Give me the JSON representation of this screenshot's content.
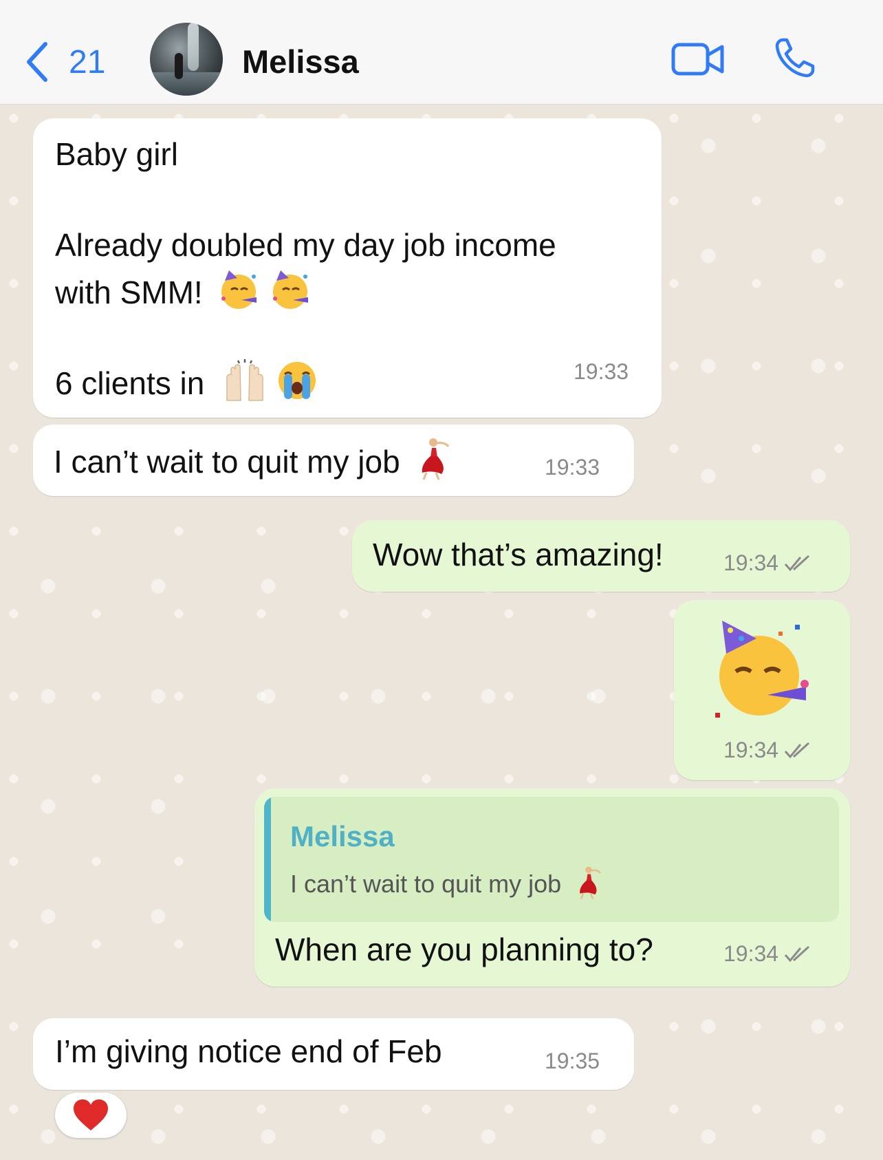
{
  "header": {
    "back_count": "21",
    "contact_name": "Melissa",
    "icons": [
      "chevron-left-icon",
      "video-call-icon",
      "phone-call-icon"
    ]
  },
  "messages": [
    {
      "direction": "incoming",
      "lines": [
        "Baby girl",
        "",
        "Already doubled my day job income",
        "with SMM!",
        "",
        "6 clients in"
      ],
      "emojis": [
        "partying-face",
        "partying-face",
        "raising-hands",
        "loudly-crying-face"
      ],
      "time": "19:33"
    },
    {
      "direction": "incoming",
      "text": "I can’t wait to quit my job",
      "emojis": [
        "woman-dancing"
      ],
      "time": "19:33"
    },
    {
      "direction": "outgoing",
      "text": "Wow that’s amazing!",
      "time": "19:34",
      "status": "read"
    },
    {
      "direction": "outgoing",
      "sticker": "partying-face",
      "time": "19:34",
      "status": "read"
    },
    {
      "direction": "outgoing",
      "reply": {
        "name": "Melissa",
        "text": "I can’t wait to quit my job"
      },
      "text": "When are you planning to?",
      "time": "19:34",
      "status": "read"
    },
    {
      "direction": "incoming",
      "text": "I’m giving notice end of Feb",
      "time": "19:35",
      "reaction": "red-heart"
    }
  ],
  "colors": {
    "accent": "#2F7CF6",
    "incoming_bubble": "#FFFFFF",
    "outgoing_bubble": "#E5F8D3",
    "reply_name": "#4FB0C6",
    "chat_background": "#ECE5DC"
  }
}
